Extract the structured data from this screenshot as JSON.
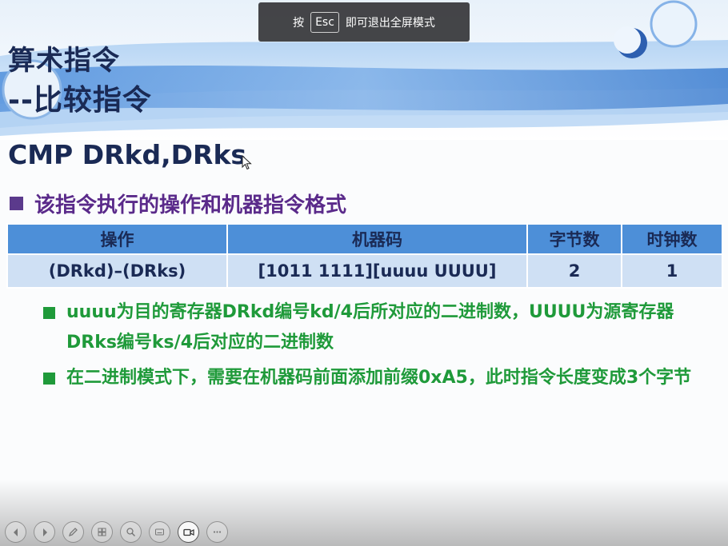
{
  "fullscreen_hint": {
    "prefix": "按",
    "key": "Esc",
    "suffix": "即可退出全屏模式"
  },
  "slide": {
    "title_line1": "算术指令",
    "title_line2": "--比较指令",
    "instruction": "CMP DRkd,DRks",
    "section_heading": "该指令执行的操作和机器指令格式",
    "table": {
      "headers": [
        "操作",
        "机器码",
        "字节数",
        "时钟数"
      ],
      "row": [
        "(DRkd)–(DRks)",
        "[1011 1111][uuuu UUUU]",
        "2",
        "1"
      ]
    },
    "bullets": [
      "uuuu为目的寄存器DRkd编号kd/4后所对应的二进制数，UUUU为源寄存器DRks编号ks/4后对应的二进制数",
      "在二进制模式下，需要在机器码前面添加前缀0xA5，此时指令长度变成3个字节"
    ]
  },
  "controls": [
    {
      "icon": "prev-icon"
    },
    {
      "icon": "next-icon"
    },
    {
      "icon": "pen-icon"
    },
    {
      "icon": "slides-icon"
    },
    {
      "icon": "zoom-icon"
    },
    {
      "icon": "subtitle-icon"
    },
    {
      "icon": "camera-icon"
    },
    {
      "icon": "more-icon"
    }
  ],
  "colors": {
    "title": "#1a2a55",
    "heading": "#5a2a8a",
    "bullet": "#1f9a3a",
    "table_header": "#4d8fd8",
    "table_row": "#cfe0f4"
  }
}
